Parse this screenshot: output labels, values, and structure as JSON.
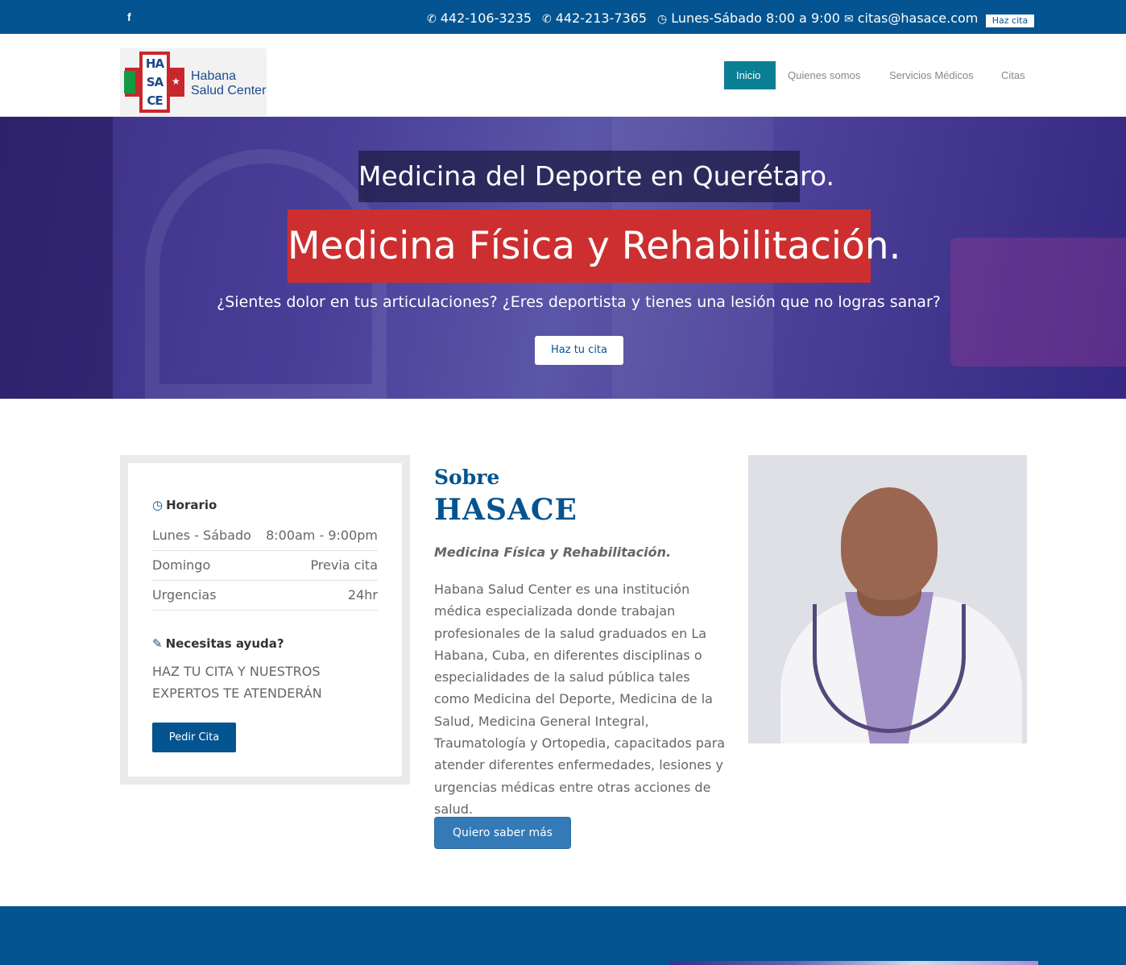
{
  "topbar": {
    "social_icon": "facebook-icon",
    "phone1": "442-106-3235",
    "phone2": "442-213-7365",
    "hours": "Lunes-Sábado 8:00 a 9:00",
    "email": "citas@hasace.com",
    "cta": "Haz cita"
  },
  "brand": {
    "logo_letters": [
      "HA",
      "SA",
      "CE"
    ],
    "name_line1": "Habana",
    "name_line2": "Salud Center",
    "colors": {
      "primary": "#035490",
      "red": "#cd2f30",
      "green": "#159a43",
      "teal": "#0a7f94"
    }
  },
  "nav": {
    "items": [
      "Inicio",
      "Quienes somos",
      "Servicios Médicos",
      "Citas"
    ],
    "active": "Inicio"
  },
  "hero": {
    "title1": "Medicina del Deporte en Querétaro.",
    "title2": "Medicina Física y Rehabilitación.",
    "subtitle": "¿Sientes dolor en tus articulaciones? ¿Eres deportista y tienes una lesión que no logras sanar?",
    "button": "Haz tu cita"
  },
  "schedule": {
    "heading": "Horario",
    "rows": [
      {
        "day": "Lunes - Sábado",
        "time": "8:00am - 9:00pm"
      },
      {
        "day": "Domingo",
        "time": "Previa cita"
      },
      {
        "day": "Urgencias",
        "time": "24hr"
      }
    ],
    "help_heading": "Necesitas ayuda?",
    "help_text": "HAZ TU CITA Y NUESTROS EXPERTOS TE ATENDERÁN",
    "button": "Pedir Cita"
  },
  "about": {
    "kicker": "Sobre",
    "title": "HASACE",
    "tagline": "Medicina Física y Rehabilitación.",
    "body": "Habana Salud Center es una institución médica especializada donde trabajan profesionales de la salud graduados en La Habana, Cuba, en diferentes disciplinas o especialidades de la salud pública tales como Medicina del Deporte, Medicina de la Salud, Medicina General Integral, Traumatología y Ortopedia, capacitados para atender diferentes enfermedades, lesiones y urgencias médicas entre otras acciones de salud.",
    "button": "Quiero saber más"
  }
}
